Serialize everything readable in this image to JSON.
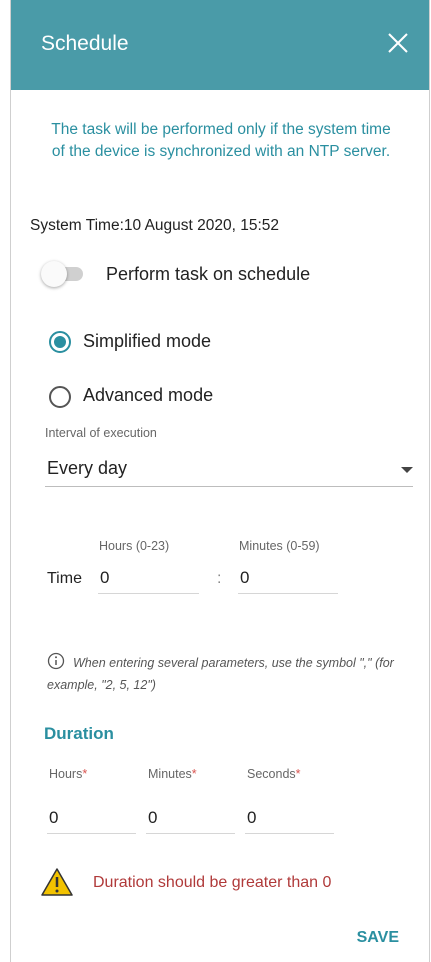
{
  "dialog": {
    "title": "Schedule",
    "notice": "The task will be performed only if the system time of the device is synchronized with an NTP server.",
    "system_time_label": "System Time:",
    "system_time_value": "10 August 2020, 15:52"
  },
  "schedule_toggle": {
    "label": "Perform task on schedule",
    "on": false
  },
  "modes": [
    {
      "label": "Simplified mode",
      "selected": true
    },
    {
      "label": "Advanced mode",
      "selected": false
    }
  ],
  "interval": {
    "label": "Interval of execution",
    "value": "Every day"
  },
  "time": {
    "label": "Time",
    "hours_label": "Hours (0-23)",
    "minutes_label": "Minutes (0-59)",
    "hours_value": "0",
    "minutes_value": "0",
    "separator": ":"
  },
  "hint": "When entering several parameters, use the symbol \",\" (for example, \"2, 5, 12\")",
  "duration": {
    "title": "Duration",
    "hours_label": "Hours",
    "minutes_label": "Minutes",
    "seconds_label": "Seconds",
    "required_mark": "*",
    "hours_value": "0",
    "minutes_value": "0",
    "seconds_value": "0"
  },
  "error": "Duration should be greater than 0",
  "save_label": "SAVE",
  "colors": {
    "header": "#4a9ba8",
    "accent": "#2a8fa0",
    "error": "#b03a3a",
    "warning_icon": "#f2c200"
  },
  "icons": {
    "close": "close-icon",
    "info": "info-icon",
    "warning": "warning-icon",
    "dropdown": "chevron-down-icon"
  }
}
